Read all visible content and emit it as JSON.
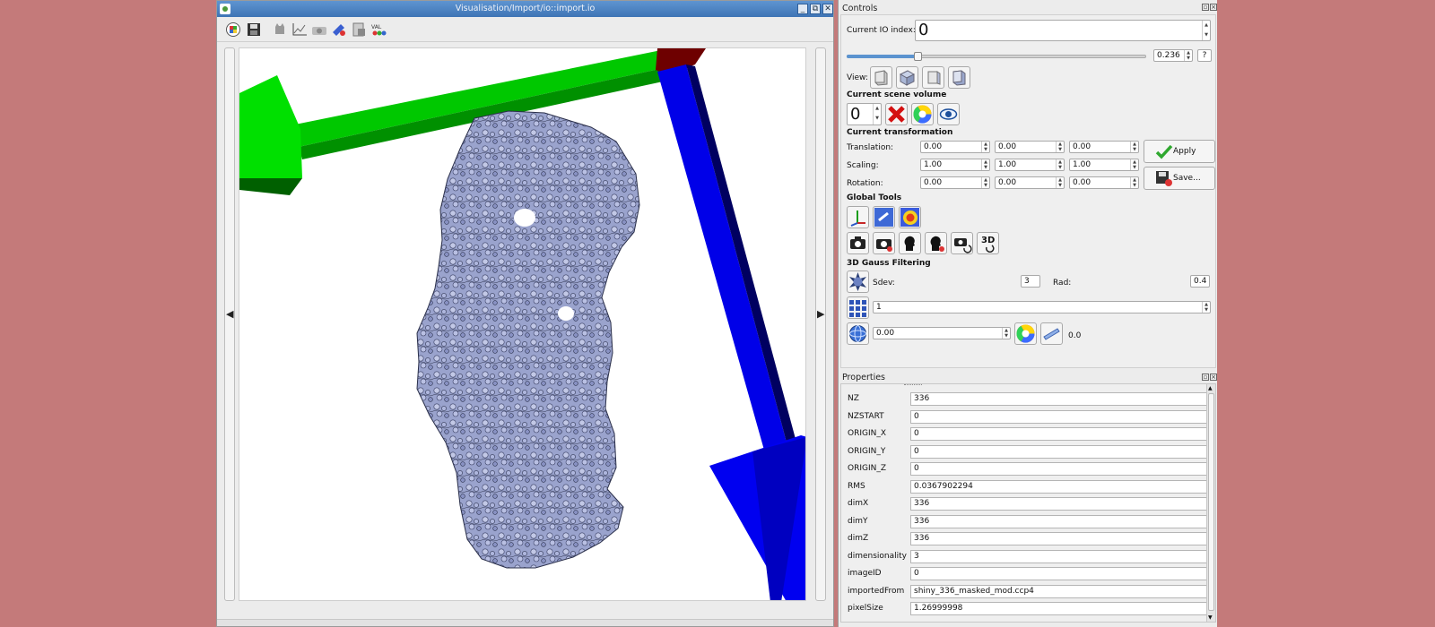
{
  "viewer": {
    "title": "Visualisation/Import/io::import.io",
    "win_min": "_",
    "win_max": "⧉",
    "win_close": "✕",
    "nav_left": "◀",
    "nav_right": "▶"
  },
  "controls": {
    "title": "Controls",
    "io_index_label": "Current IO index:",
    "io_index_value": "0",
    "slider_value": 0.236,
    "slider_text": "0.236",
    "help_label": "?",
    "view_label": "View:",
    "scene_volume_heading": "Current scene volume",
    "scene_volume_value": "0",
    "transformation_heading": "Current transformation",
    "translation_label": "Translation:",
    "translation": [
      "0.00",
      "0.00",
      "0.00"
    ],
    "scaling_label": "Scaling:",
    "scaling": [
      "1.00",
      "1.00",
      "1.00"
    ],
    "rotation_label": "Rotation:",
    "rotation": [
      "0.00",
      "0.00",
      "0.00"
    ],
    "apply_label": "Apply",
    "save_label": "Save...",
    "global_tools_heading": "Global Tools",
    "tool_3d_label": "3D",
    "gauss_heading": "3D Gauss Filtering",
    "sdev_label": "Sdev:",
    "sdev_value": "3",
    "rad_label": "Rad:",
    "rad_value": "0.4",
    "grid_value": "1",
    "threshold_value": "0.00",
    "threshold_readout": "0.0"
  },
  "properties": {
    "title": "Properties",
    "rows": [
      {
        "key": "NZ",
        "value": "336"
      },
      {
        "key": "NZSTART",
        "value": "0"
      },
      {
        "key": "ORIGIN_X",
        "value": "0"
      },
      {
        "key": "ORIGIN_Y",
        "value": "0"
      },
      {
        "key": "ORIGIN_Z",
        "value": "0"
      },
      {
        "key": "RMS",
        "value": "0.0367902294"
      },
      {
        "key": "dimX",
        "value": "336"
      },
      {
        "key": "dimY",
        "value": "336"
      },
      {
        "key": "dimZ",
        "value": "336"
      },
      {
        "key": "dimensionality",
        "value": "3"
      },
      {
        "key": "imageID",
        "value": "0"
      },
      {
        "key": "importedFrom",
        "value": "shiny_336_masked_mod.ccp4"
      },
      {
        "key": "pixelSize",
        "value": "1.26999998"
      }
    ]
  },
  "colors": {
    "background": "#c47a7a",
    "titlebar": "#4a80c0",
    "axis_x": "#00cc00",
    "axis_y": "#0000ee",
    "axis_z": "#7a0000",
    "volume_surface": "#aab2d6"
  }
}
